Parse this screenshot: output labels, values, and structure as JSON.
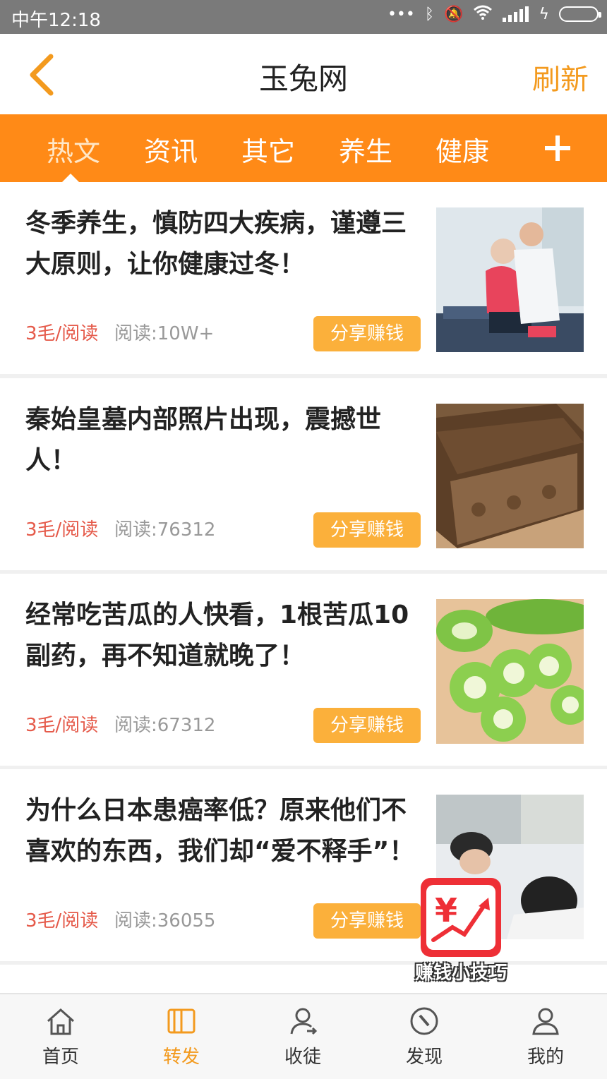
{
  "status_bar": {
    "time": "中午12:18"
  },
  "header": {
    "title": "玉兔网",
    "refresh_label": "刷新"
  },
  "tabs": [
    {
      "label": "热文",
      "active": true
    },
    {
      "label": "资讯",
      "active": false
    },
    {
      "label": "其它",
      "active": false
    },
    {
      "label": "养生",
      "active": false
    },
    {
      "label": "健康",
      "active": false
    }
  ],
  "articles": [
    {
      "title": "冬季养生，慎防四大疾病，谨遵三大原则，让你健康过冬！",
      "price": "3毛/阅读",
      "reads": "阅读:10W+",
      "share_label": "分享赚钱",
      "image_icon": "doctor-patient-photo"
    },
    {
      "title": "秦始皇墓内部照片出现，震撼世人！",
      "price": "3毛/阅读",
      "reads": "阅读:76312",
      "share_label": "分享赚钱",
      "image_icon": "ancient-coffin-photo"
    },
    {
      "title": "经常吃苦瓜的人快看，1根苦瓜10副药，再不知道就晚了！",
      "price": "3毛/阅读",
      "reads": "阅读:67312",
      "share_label": "分享赚钱",
      "image_icon": "bitter-melon-photo"
    },
    {
      "title": "为什么日本患癌率低？原来他们不喜欢的东西，我们却“爱不释手”！",
      "price": "3毛/阅读",
      "reads": "阅读:36055",
      "share_label": "分享赚钱",
      "image_icon": "hospital-bed-photo"
    }
  ],
  "float_badge": {
    "label": "赚钱小技巧",
    "icon": "yen-chart-icon"
  },
  "bottom_nav": [
    {
      "label": "首页",
      "icon": "home-icon",
      "active": false
    },
    {
      "label": "转发",
      "icon": "book-icon",
      "active": true
    },
    {
      "label": "收徒",
      "icon": "add-user-icon",
      "active": false
    },
    {
      "label": "发现",
      "icon": "compass-icon",
      "active": false
    },
    {
      "label": "我的",
      "icon": "person-icon",
      "active": false
    }
  ],
  "colors": {
    "accent": "#ff8a17",
    "button": "#fbb03b",
    "price": "#e55a4a",
    "active_nav": "#f39a1e"
  }
}
